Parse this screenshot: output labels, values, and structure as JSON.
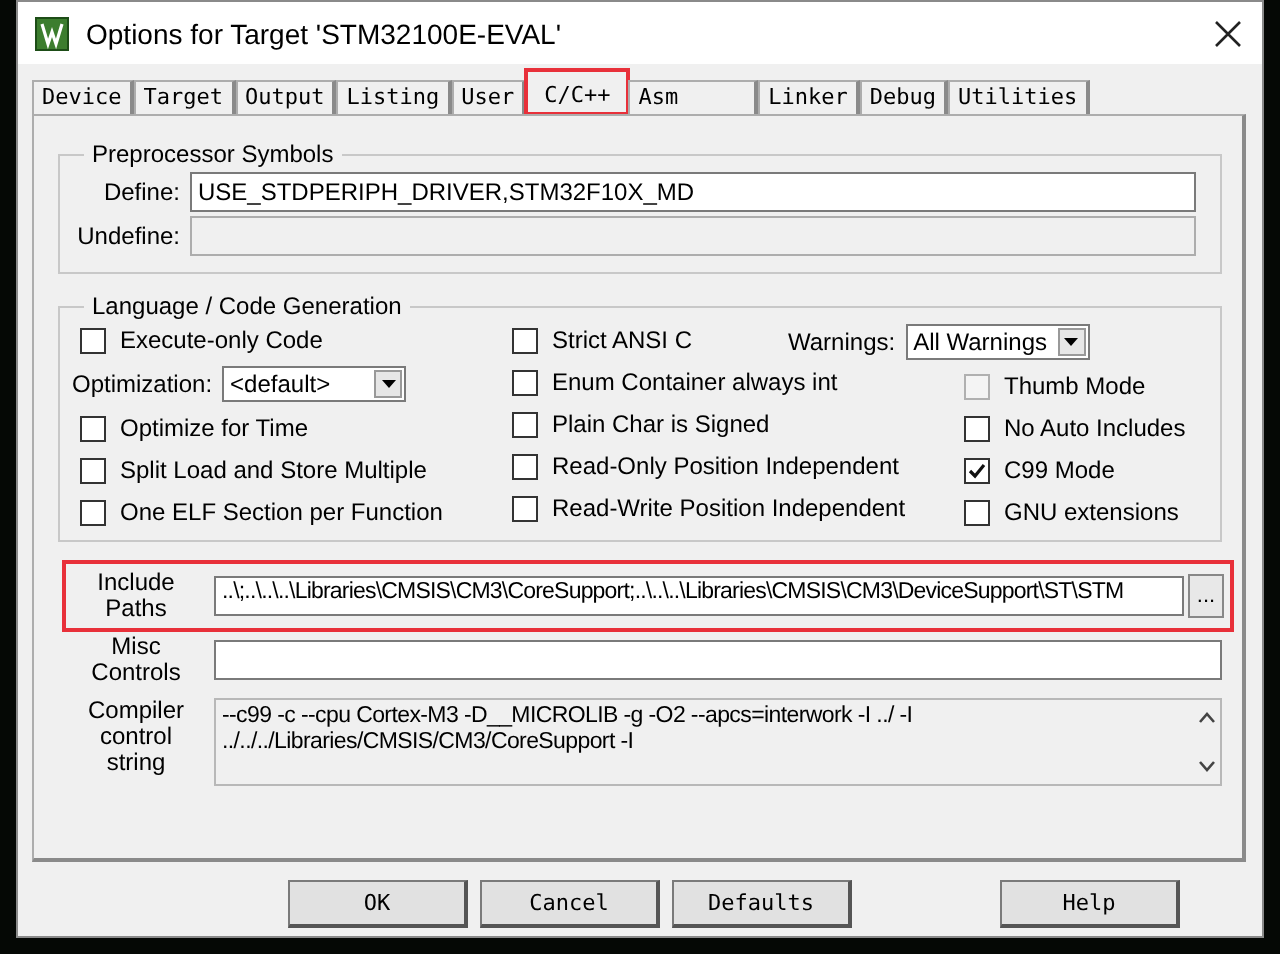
{
  "window": {
    "title": "Options for Target 'STM32100E-EVAL'"
  },
  "tabs": [
    {
      "label": "Device",
      "selected": false,
      "highlighted": false
    },
    {
      "label": "Target",
      "selected": false,
      "highlighted": false
    },
    {
      "label": "Output",
      "selected": false,
      "highlighted": false
    },
    {
      "label": "Listing",
      "selected": false,
      "highlighted": false
    },
    {
      "label": "User",
      "selected": false,
      "highlighted": false
    },
    {
      "label": "C/C++",
      "selected": true,
      "highlighted": true
    },
    {
      "label": "Asm",
      "selected": false,
      "highlighted": false
    },
    {
      "label": "Linker",
      "selected": false,
      "highlighted": false
    },
    {
      "label": "Debug",
      "selected": false,
      "highlighted": false
    },
    {
      "label": "Utilities",
      "selected": false,
      "highlighted": false
    }
  ],
  "preprocessor": {
    "title": "Preprocessor Symbols",
    "fields": [
      {
        "label": "Define:",
        "value": "USE_STDPERIPH_DRIVER,STM32F10X_MD",
        "disabled": false
      },
      {
        "label": "Undefine:",
        "disabled": true
      }
    ]
  },
  "language": {
    "title": "Language / Code Generation",
    "columns": [
      [
        {
          "kind": "checkbox",
          "label": "Execute-only Code",
          "checked": false,
          "disabled": false
        },
        {
          "kind": "select",
          "label": "Optimization:",
          "value": "<default>"
        },
        {
          "kind": "checkbox",
          "label": "Optimize for Time",
          "checked": false,
          "disabled": false
        },
        {
          "kind": "checkbox",
          "label": "Split Load and Store Multiple",
          "checked": false,
          "disabled": false
        },
        {
          "kind": "checkbox",
          "label": "One ELF Section per Function",
          "checked": false,
          "disabled": false
        }
      ],
      [
        {
          "kind": "checkbox",
          "label": "Strict ANSI C",
          "checked": false,
          "disabled": false
        },
        {
          "kind": "checkbox",
          "label": "Enum Container always int",
          "checked": false,
          "disabled": false
        },
        {
          "kind": "checkbox",
          "label": "Plain Char is Signed",
          "checked": false,
          "disabled": false
        },
        {
          "kind": "checkbox",
          "label": "Read-Only Position Independent",
          "checked": false,
          "disabled": false
        },
        {
          "kind": "checkbox",
          "label": "Read-Write Position Independent",
          "checked": false,
          "disabled": false
        }
      ],
      [
        {
          "kind": "select",
          "label": "Warnings:",
          "value": "All Warnings"
        },
        {
          "kind": "checkbox",
          "label": "Thumb Mode",
          "checked": false,
          "disabled": true
        },
        {
          "kind": "checkbox",
          "label": "No Auto Includes",
          "checked": false,
          "disabled": false
        },
        {
          "kind": "checkbox",
          "label": "C99 Mode",
          "checked": true,
          "disabled": false
        },
        {
          "kind": "checkbox",
          "label": "GNU extensions",
          "checked": false,
          "disabled": false
        }
      ]
    ]
  },
  "include_paths": {
    "label": "Include Paths",
    "value": "..\\;..\\..\\..\\Libraries\\CMSIS\\CM3\\CoreSupport;..\\..\\..\\Libraries\\CMSIS\\CM3\\DeviceSupport\\ST\\STM",
    "browse": "...",
    "highlighted": true
  },
  "misc_controls": {
    "label": "Misc Controls"
  },
  "compiler_string": {
    "label": "Compiler control string",
    "lines": [
      "--c99 -c --cpu Cortex-M3 -D__MICROLIB -g -O2 --apcs=interwork -I ../ -I",
      "../../../Libraries/CMSIS/CM3/CoreSupport -I"
    ]
  },
  "buttons": [
    "OK",
    "Cancel",
    "Defaults",
    "Help"
  ]
}
